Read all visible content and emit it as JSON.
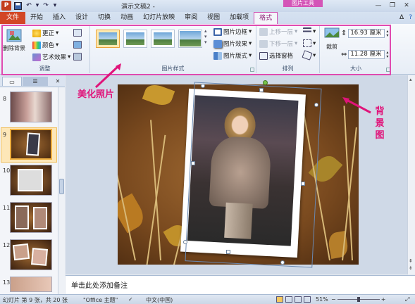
{
  "titlebar": {
    "title": "演示文稿2 - ",
    "context_group": "图片工具"
  },
  "tabs": [
    "文件",
    "开始",
    "插入",
    "设计",
    "切换",
    "动画",
    "幻灯片放映",
    "审阅",
    "视图",
    "加载项",
    "格式"
  ],
  "ribbon": {
    "adjust": {
      "label": "调整",
      "remove_bg": "删除背景",
      "corrections": "更正",
      "color": "颜色",
      "artistic": "艺术效果"
    },
    "picture_styles": {
      "label": "图片样式",
      "border": "图片边框",
      "effects": "图片效果",
      "layout": "图片版式"
    },
    "arrange": {
      "label": "排列",
      "bring_forward": "上移一层",
      "send_backward": "下移一层",
      "selection_pane": "选择窗格"
    },
    "size": {
      "label": "大小",
      "crop": "裁剪",
      "height": "16.93",
      "width": "11.28",
      "unit": "厘米"
    }
  },
  "slides": [
    {
      "num": "8"
    },
    {
      "num": "9"
    },
    {
      "num": "10"
    },
    {
      "num": "11"
    },
    {
      "num": "12"
    },
    {
      "num": "13"
    }
  ],
  "annotations": {
    "beautify": "美化照片",
    "background": [
      "背",
      "景",
      "图"
    ]
  },
  "notes": {
    "placeholder": "单击此处添加备注"
  },
  "status": {
    "slide_info": "幻灯片 第 9 张，共 20 张",
    "theme": "\"Office 主题\"",
    "language": "中文(中国)",
    "zoom": "51%"
  },
  "colors": {
    "file_tab": "#d24726",
    "context": "#d455b7",
    "annotation": "#e0147a"
  }
}
